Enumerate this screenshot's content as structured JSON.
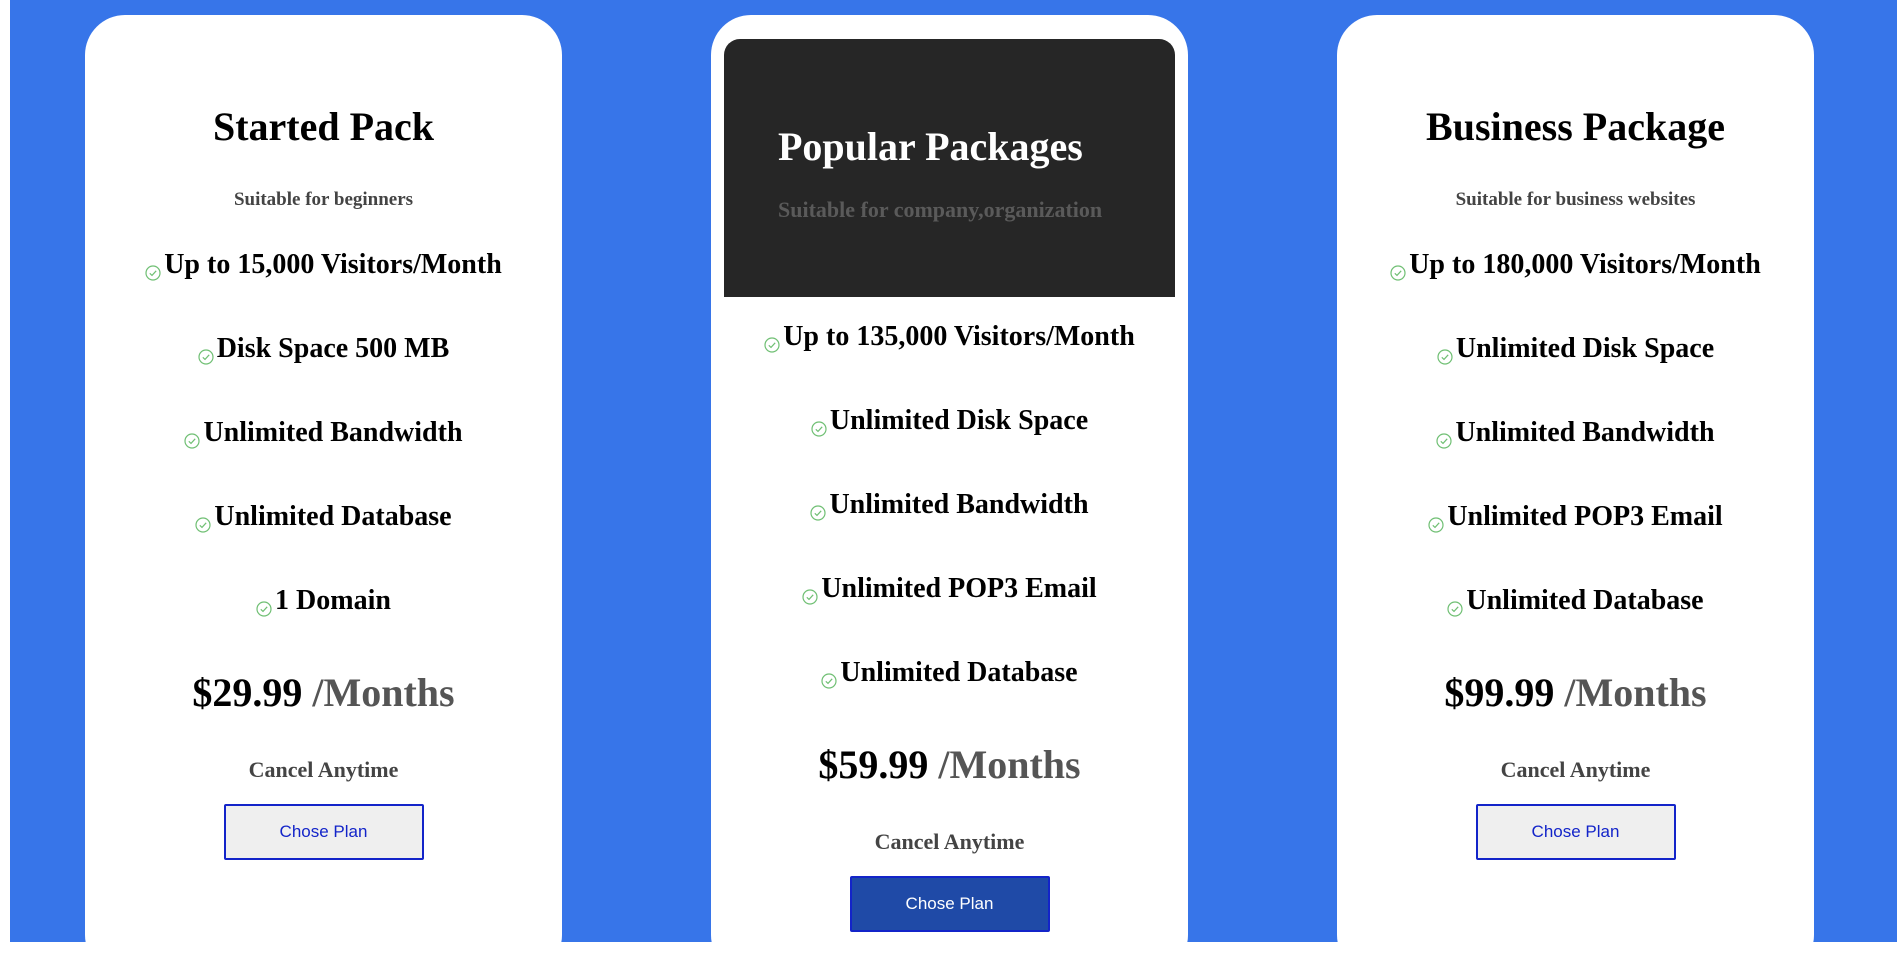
{
  "plans": [
    {
      "title": "Started Pack",
      "subtitle": "Suitable for beginners",
      "features": [
        "Up to 15,000 Visitors/Month",
        "Disk Space 500 MB",
        "Unlimited Bandwidth",
        "Unlimited Database",
        "1 Domain"
      ],
      "price": "$29.99",
      "period": "/Months",
      "cancel": "Cancel Anytime",
      "button": "Chose Plan"
    },
    {
      "title": "Popular Packages",
      "subtitle": "Suitable for company,organization",
      "features": [
        "Up to 135,000 Visitors/Month",
        "Unlimited Disk Space",
        "Unlimited Bandwidth",
        "Unlimited POP3 Email",
        "Unlimited Database"
      ],
      "price": "$59.99",
      "period": "/Months",
      "cancel": "Cancel Anytime",
      "button": "Chose Plan"
    },
    {
      "title": "Business Package",
      "subtitle": "Suitable for business websites",
      "features": [
        "Up to 180,000 Visitors/Month",
        "Unlimited Disk Space",
        "Unlimited Bandwidth",
        "Unlimited POP3 Email",
        "Unlimited Database"
      ],
      "price": "$99.99",
      "period": "/Months",
      "cancel": "Cancel Anytime",
      "button": "Chose Plan"
    }
  ],
  "icons": {
    "feature": "check-circle-icon"
  },
  "colors": {
    "background": "#3775e9",
    "card": "#ffffff",
    "popular_header": "#262626",
    "check": "#6fbf73",
    "button_border": "#1324c9",
    "primary_button": "#1f4aa7"
  }
}
